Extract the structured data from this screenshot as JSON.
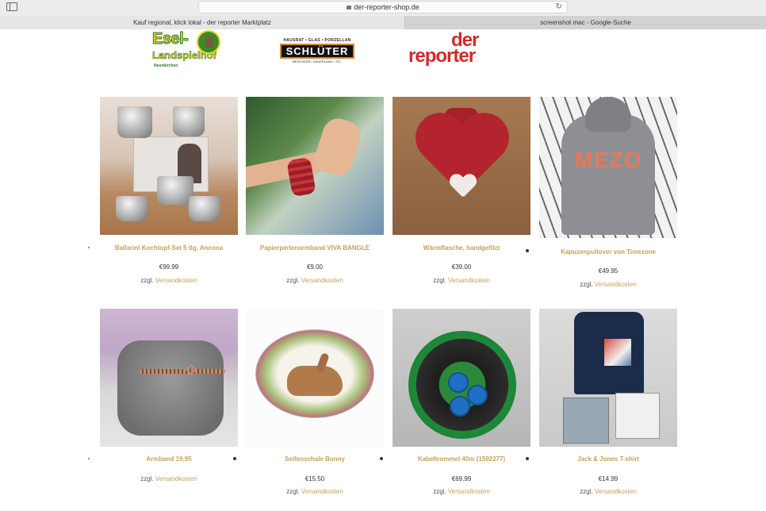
{
  "browser": {
    "url": "der-reporter-shop.de",
    "tabs": [
      {
        "label": "Kauf regional, klick lokal - der reporter Marktplatz",
        "active": true
      },
      {
        "label": "screenshot mac - Google-Suche",
        "active": false
      }
    ]
  },
  "logos": {
    "esel": {
      "line1": "Esel-",
      "line2": "Landspielhof",
      "line3": "Neunkirchen"
    },
    "schlueter": {
      "top": "HAUSRAT • GLAS • PORZELLAN",
      "name": "SCHLÜTER",
      "bottom": "MESCHEDE • SAUERLAND • TEL."
    },
    "reporter": {
      "line1": "der",
      "line2": "reporter"
    }
  },
  "colors": {
    "accent": "#c5a05a",
    "text": "#333333",
    "brand_red": "#d42a2a"
  },
  "shipping_prefix": "zzgl.",
  "shipping_link": "Versandkosten",
  "products": [
    {
      "title": "Ballarini Kochtopf-Set 5 tlg. Ancona",
      "price": "€99.99",
      "image": "cookware-set"
    },
    {
      "title": "Papierperlenarmband VIVA BANGLE",
      "price": "€9.00",
      "image": "paper-bead-bracelet"
    },
    {
      "title": "Wärmflasche, handgefilzt",
      "price": "€39.00",
      "image": "felt-hot-water-bottle"
    },
    {
      "title": "Kapuzenpullover von Timezone",
      "price": "€49.95",
      "image": "grey-hoodie"
    },
    {
      "title": "Armband 19,95",
      "price": "",
      "image": "charm-bracelet"
    },
    {
      "title": "Seifenschale Bunny",
      "price": "€15.50",
      "image": "bunny-soap-dish"
    },
    {
      "title": "Kabeltrommel 40m (1592277)",
      "price": "€69.99",
      "image": "cable-reel"
    },
    {
      "title": "Jack & Jones T-shirt",
      "price": "€14.99",
      "image": "tshirts"
    }
  ]
}
